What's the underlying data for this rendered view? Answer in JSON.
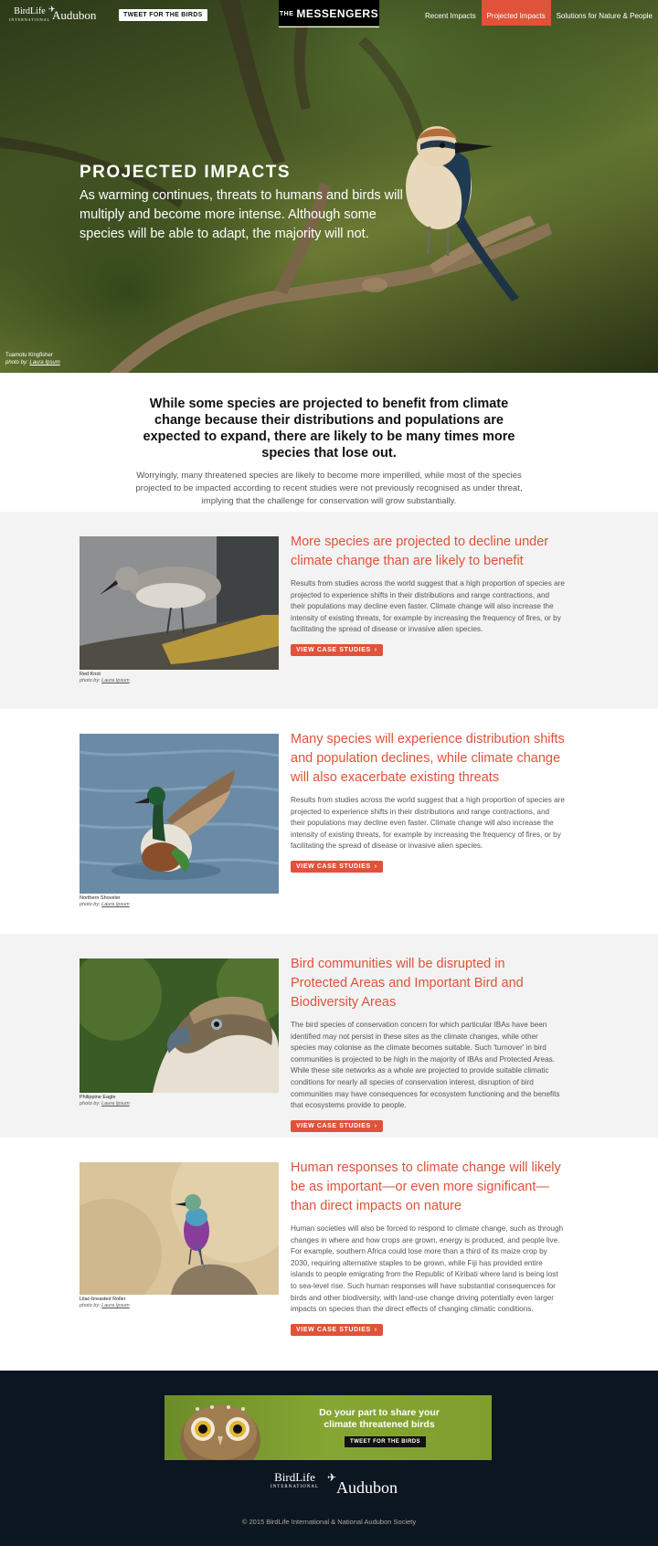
{
  "header": {
    "birdlife_logo": "BirdLife",
    "birdlife_logo_sub": "INTERNATIONAL",
    "audubon_logo": "Audubon",
    "tweet_button": "TWEET FOR THE BIRDS",
    "brand_the": "THE",
    "brand_name": "MESSENGERS",
    "nav": [
      {
        "label": "Recent Impacts",
        "active": false
      },
      {
        "label": "Projected Impacts",
        "active": true
      },
      {
        "label": "Solutions for Nature & People",
        "active": false
      }
    ]
  },
  "hero": {
    "title": "PROJECTED IMPACTS",
    "text": "As warming continues, threats to humans and birds will multiply and become more intense. Although some species will be able to adapt, the majority will not.",
    "caption_species": "Tuamotu Kingfisher",
    "caption_prefix": "photo by:",
    "caption_credit": "Laura Ipsum"
  },
  "intro": {
    "heading": "While some species are projected to benefit from climate change because their distributions and populations are expected to expand, there are likely to be many times more species that lose out.",
    "text": "Worryingly, many threatened species are likely to become more imperilled, while most of the species projected to be impacted according to recent studies were not previously recognised as under threat, implying that the challenge for conservation will grow substantially."
  },
  "sections": [
    {
      "title": "More species are projected to decline under climate change than are likely to benefit",
      "body": "Results from studies across the world suggest that a high proportion of species are projected to experience shifts in their distributions and range contractions, and their populations may decline even faster. Climate change will also increase the intensity of existing threats, for example by increasing the frequency of fires, or by facilitating the spread of disease or invasive alien species.",
      "cta": "VIEW CASE STUDIES",
      "caption_species": "Red Knot",
      "caption_prefix": "photo by:",
      "caption_credit": "Laura Ipsum"
    },
    {
      "title": "Many species will experience distribution shifts and population declines, while climate change will also exacerbate existing threats",
      "body": "Results from studies across the world suggest that a high proportion of species are projected to experience shifts in their distributions and range contractions, and their populations may decline even faster. Climate change will also increase the intensity of existing threats, for example by increasing the frequency of fires, or by facilitating the spread of disease or invasive alien species.",
      "cta": "VIEW CASE STUDIES",
      "caption_species": "Northern Shoveler",
      "caption_prefix": "photo by:",
      "caption_credit": "Laura Ipsum"
    },
    {
      "title": "Bird communities will be disrupted in Protected Areas and Important Bird and Biodiversity Areas",
      "body": "The bird species of conservation concern for which particular IBAs have been identified may not persist in these sites as the climate changes, while other species may colonise as the climate becomes suitable. Such 'turnover' in bird communities is projected to be high in the majority of IBAs and Protected Areas. While these site networks as a whole are projected to provide suitable climatic conditions for nearly all species of conservation interest, disruption of bird communities may have consequences for ecosystem functioning and the benefits that ecosystems provide to people.",
      "cta": "VIEW CASE STUDIES",
      "caption_species": "Philippine Eagle",
      "caption_prefix": "photo by:",
      "caption_credit": "Laura Ipsum"
    },
    {
      "title": "Human responses to climate change will likely be as important—or even more significant—than direct impacts on nature",
      "body": "Human societies will also be forced to respond to climate change, such as through changes in where and how crops are grown, energy is produced, and people live. For example, southern Africa could lose more than a third of its maize crop by 2030, requiring alternative staples to be grown, while Fiji has provided entire islands to people emigrating from the Republic of Kiribati where land is being lost to sea-level rise. Such human responses will have substantial consequences for birds and other biodiversity, with land-use change driving potentially even larger impacts on species than the direct effects of changing climatic conditions.",
      "cta": "VIEW CASE STUDIES",
      "caption_species": "Lilac-breasted Roller",
      "caption_prefix": "photo by:",
      "caption_credit": "Laura Ipsum"
    }
  ],
  "footer": {
    "banner_message": "Do your part to share your climate threatened birds",
    "banner_button": "TWEET FOR THE BIRDS",
    "birdlife_logo": "BirdLife",
    "birdlife_logo_sub": "INTERNATIONAL",
    "audubon_logo": "Audubon",
    "copyright": "© 2015 BirdLife International & National Audubon Society"
  },
  "colors": {
    "accent": "#e0523a",
    "footer_bg": "#0c1620",
    "section_gray": "#f3f3f3"
  }
}
